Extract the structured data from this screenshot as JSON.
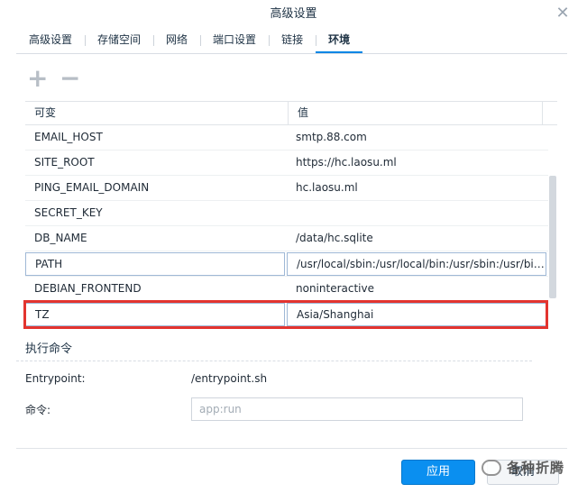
{
  "dialog": {
    "title": "高级设置",
    "close_glyph": "✕"
  },
  "tabs": [
    {
      "label": "高级设置"
    },
    {
      "label": "存储空间"
    },
    {
      "label": "网络"
    },
    {
      "label": "端口设置"
    },
    {
      "label": "链接"
    },
    {
      "label": "环境",
      "active": true
    }
  ],
  "toolbar": {
    "add_glyph": "+",
    "remove_glyph": "−"
  },
  "grid": {
    "headers": {
      "variable": "可变",
      "value": "值"
    },
    "rows": [
      {
        "variable": "EMAIL_HOST",
        "value": "smtp.88.com"
      },
      {
        "variable": "SITE_ROOT",
        "value": "https://hc.laosu.ml"
      },
      {
        "variable": "PING_EMAIL_DOMAIN",
        "value": "hc.laosu.ml"
      },
      {
        "variable": "SECRET_KEY",
        "value": ""
      },
      {
        "variable": "DB_NAME",
        "value": "/data/hc.sqlite"
      },
      {
        "variable": "PATH",
        "value": "/usr/local/sbin:/usr/local/bin:/usr/sbin:/usr/bin:/sbin:/bin"
      },
      {
        "variable": "DEBIAN_FRONTEND",
        "value": "noninteractive"
      },
      {
        "variable": "TZ",
        "value": "Asia/Shanghai"
      }
    ]
  },
  "exec": {
    "section_title": "执行命令",
    "entrypoint_label": "Entrypoint:",
    "entrypoint_value": "/entrypoint.sh",
    "command_label": "命令:",
    "command_placeholder": "app:run"
  },
  "footer": {
    "apply_label": "应用",
    "cancel_label": "取消",
    "watermark_text": "各种折腾"
  },
  "colors": {
    "accent": "#0a8ff0",
    "highlight_border": "#e3342f"
  }
}
